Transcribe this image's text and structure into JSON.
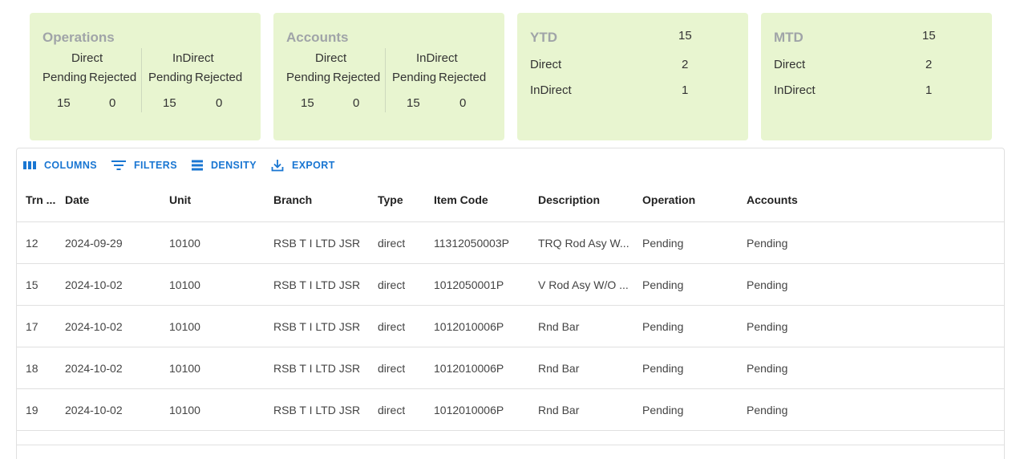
{
  "operations_card": {
    "title": "Operations",
    "direct_label": "Direct",
    "indirect_label": "InDirect",
    "pending_label": "Pending",
    "rejected_label": "Rejected",
    "direct_pending": "15",
    "direct_rejected": "0",
    "indirect_pending": "15",
    "indirect_rejected": "0"
  },
  "accounts_card": {
    "title": "Accounts",
    "direct_label": "Direct",
    "indirect_label": "InDirect",
    "pending_label": "Pending",
    "rejected_label": "Rejected",
    "direct_pending": "15",
    "direct_rejected": "0",
    "indirect_pending": "15",
    "indirect_rejected": "0"
  },
  "ytd_card": {
    "title": "YTD",
    "total": "15",
    "direct_label": "Direct",
    "direct_value": "2",
    "indirect_label": "InDirect",
    "indirect_value": "1"
  },
  "mtd_card": {
    "title": "MTD",
    "total": "15",
    "direct_label": "Direct",
    "direct_value": "2",
    "indirect_label": "InDirect",
    "indirect_value": "1"
  },
  "toolbar": {
    "columns_label": "COLUMNS",
    "filters_label": "FILTERS",
    "density_label": "DENSITY",
    "export_label": "EXPORT"
  },
  "table": {
    "headers": [
      "Trn ...",
      "Date",
      "Unit",
      "Branch",
      "Type",
      "Item Code",
      "Description",
      "Operation",
      "Accounts"
    ],
    "rows": [
      [
        "12",
        "2024-09-29",
        "10100",
        "RSB T I LTD JSR",
        "direct",
        "11312050003P",
        "TRQ Rod Asy W...",
        "Pending",
        "Pending"
      ],
      [
        "15",
        "2024-10-02",
        "10100",
        "RSB T I LTD JSR",
        "direct",
        "1012050001P",
        "V Rod Asy W/O ...",
        "Pending",
        "Pending"
      ],
      [
        "17",
        "2024-10-02",
        "10100",
        "RSB T I LTD JSR",
        "direct",
        "1012010006P",
        "Rnd Bar",
        "Pending",
        "Pending"
      ],
      [
        "18",
        "2024-10-02",
        "10100",
        "RSB T I LTD JSR",
        "direct",
        "1012010006P",
        "Rnd Bar",
        "Pending",
        "Pending"
      ],
      [
        "19",
        "2024-10-02",
        "10100",
        "RSB T I LTD JSR",
        "direct",
        "1012010006P",
        "Rnd Bar",
        "Pending",
        "Pending"
      ]
    ]
  },
  "colors": {
    "card_bg": "#e8f5d0",
    "accent": "#1976d2",
    "title_gray": "#a0a4a8"
  }
}
